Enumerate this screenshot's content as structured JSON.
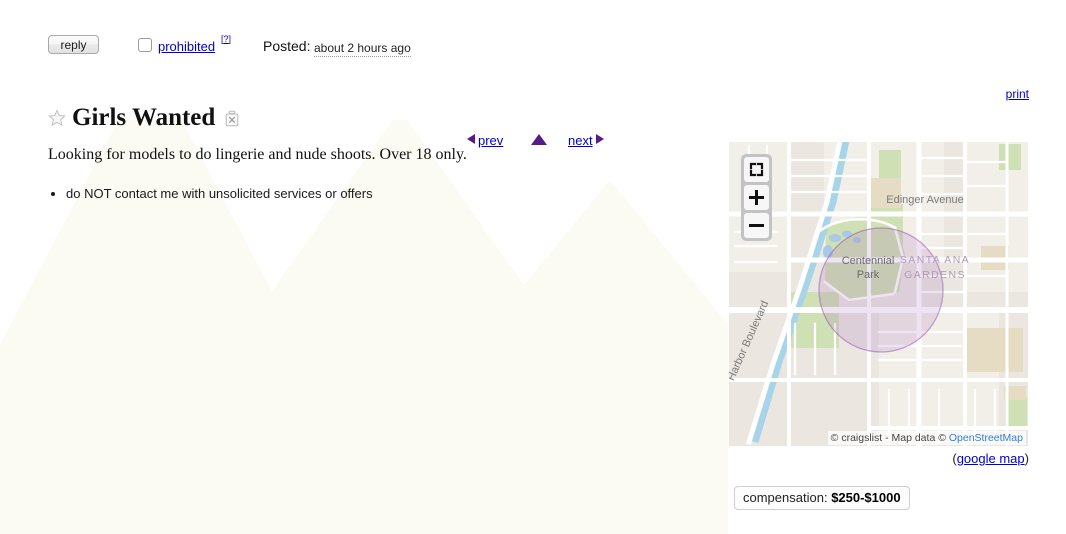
{
  "header": {
    "reply_label": "reply",
    "prohibited_label": "prohibited",
    "prohibited_help": "?",
    "posted_label": "Posted:",
    "posted_time": "about 2 hours ago"
  },
  "nav": {
    "prev_label": "prev",
    "next_label": "next",
    "up_label": "up",
    "print_label": "print"
  },
  "posting": {
    "title": "Girls Wanted",
    "favorite_icon": "star-icon",
    "delete_icon": "trash-icon",
    "body": "Looking for models to do lingerie and nude shoots. Over 18 only.",
    "notices": [
      "do NOT contact me with unsolicited services or offers"
    ]
  },
  "map": {
    "controls": {
      "fullscreen": "fullscreen-icon",
      "zoom_in": "+",
      "zoom_out": "−"
    },
    "labels": {
      "park": "Centennial Park",
      "park_line1": "Centennial",
      "park_line2": "Park",
      "neighborhood_line1": "SANTA ANA",
      "neighborhood_line2": "GARDENS",
      "street_edinger": "Edinger Avenue",
      "street_harbor": "Harbor Boulevard"
    },
    "attribution_prefix": "© craigslist - Map data © ",
    "attribution_osm": "OpenStreetMap",
    "google_map_prefix": "(",
    "google_map_label": "google map",
    "google_map_suffix": ")",
    "colors": {
      "land": "#ebe7e0",
      "road": "#ffffff",
      "park": "#cfe0b4",
      "building": "#e3d9c2",
      "water": "#a8d4ea",
      "accuracy_circle": "#9b59b6"
    }
  },
  "attributes": {
    "compensation_label": "compensation:",
    "compensation_value": "$250-$1000"
  },
  "colors": {
    "link": "#0000cc",
    "arrow": "#551a8b",
    "osm_link": "#2d7fd4"
  }
}
